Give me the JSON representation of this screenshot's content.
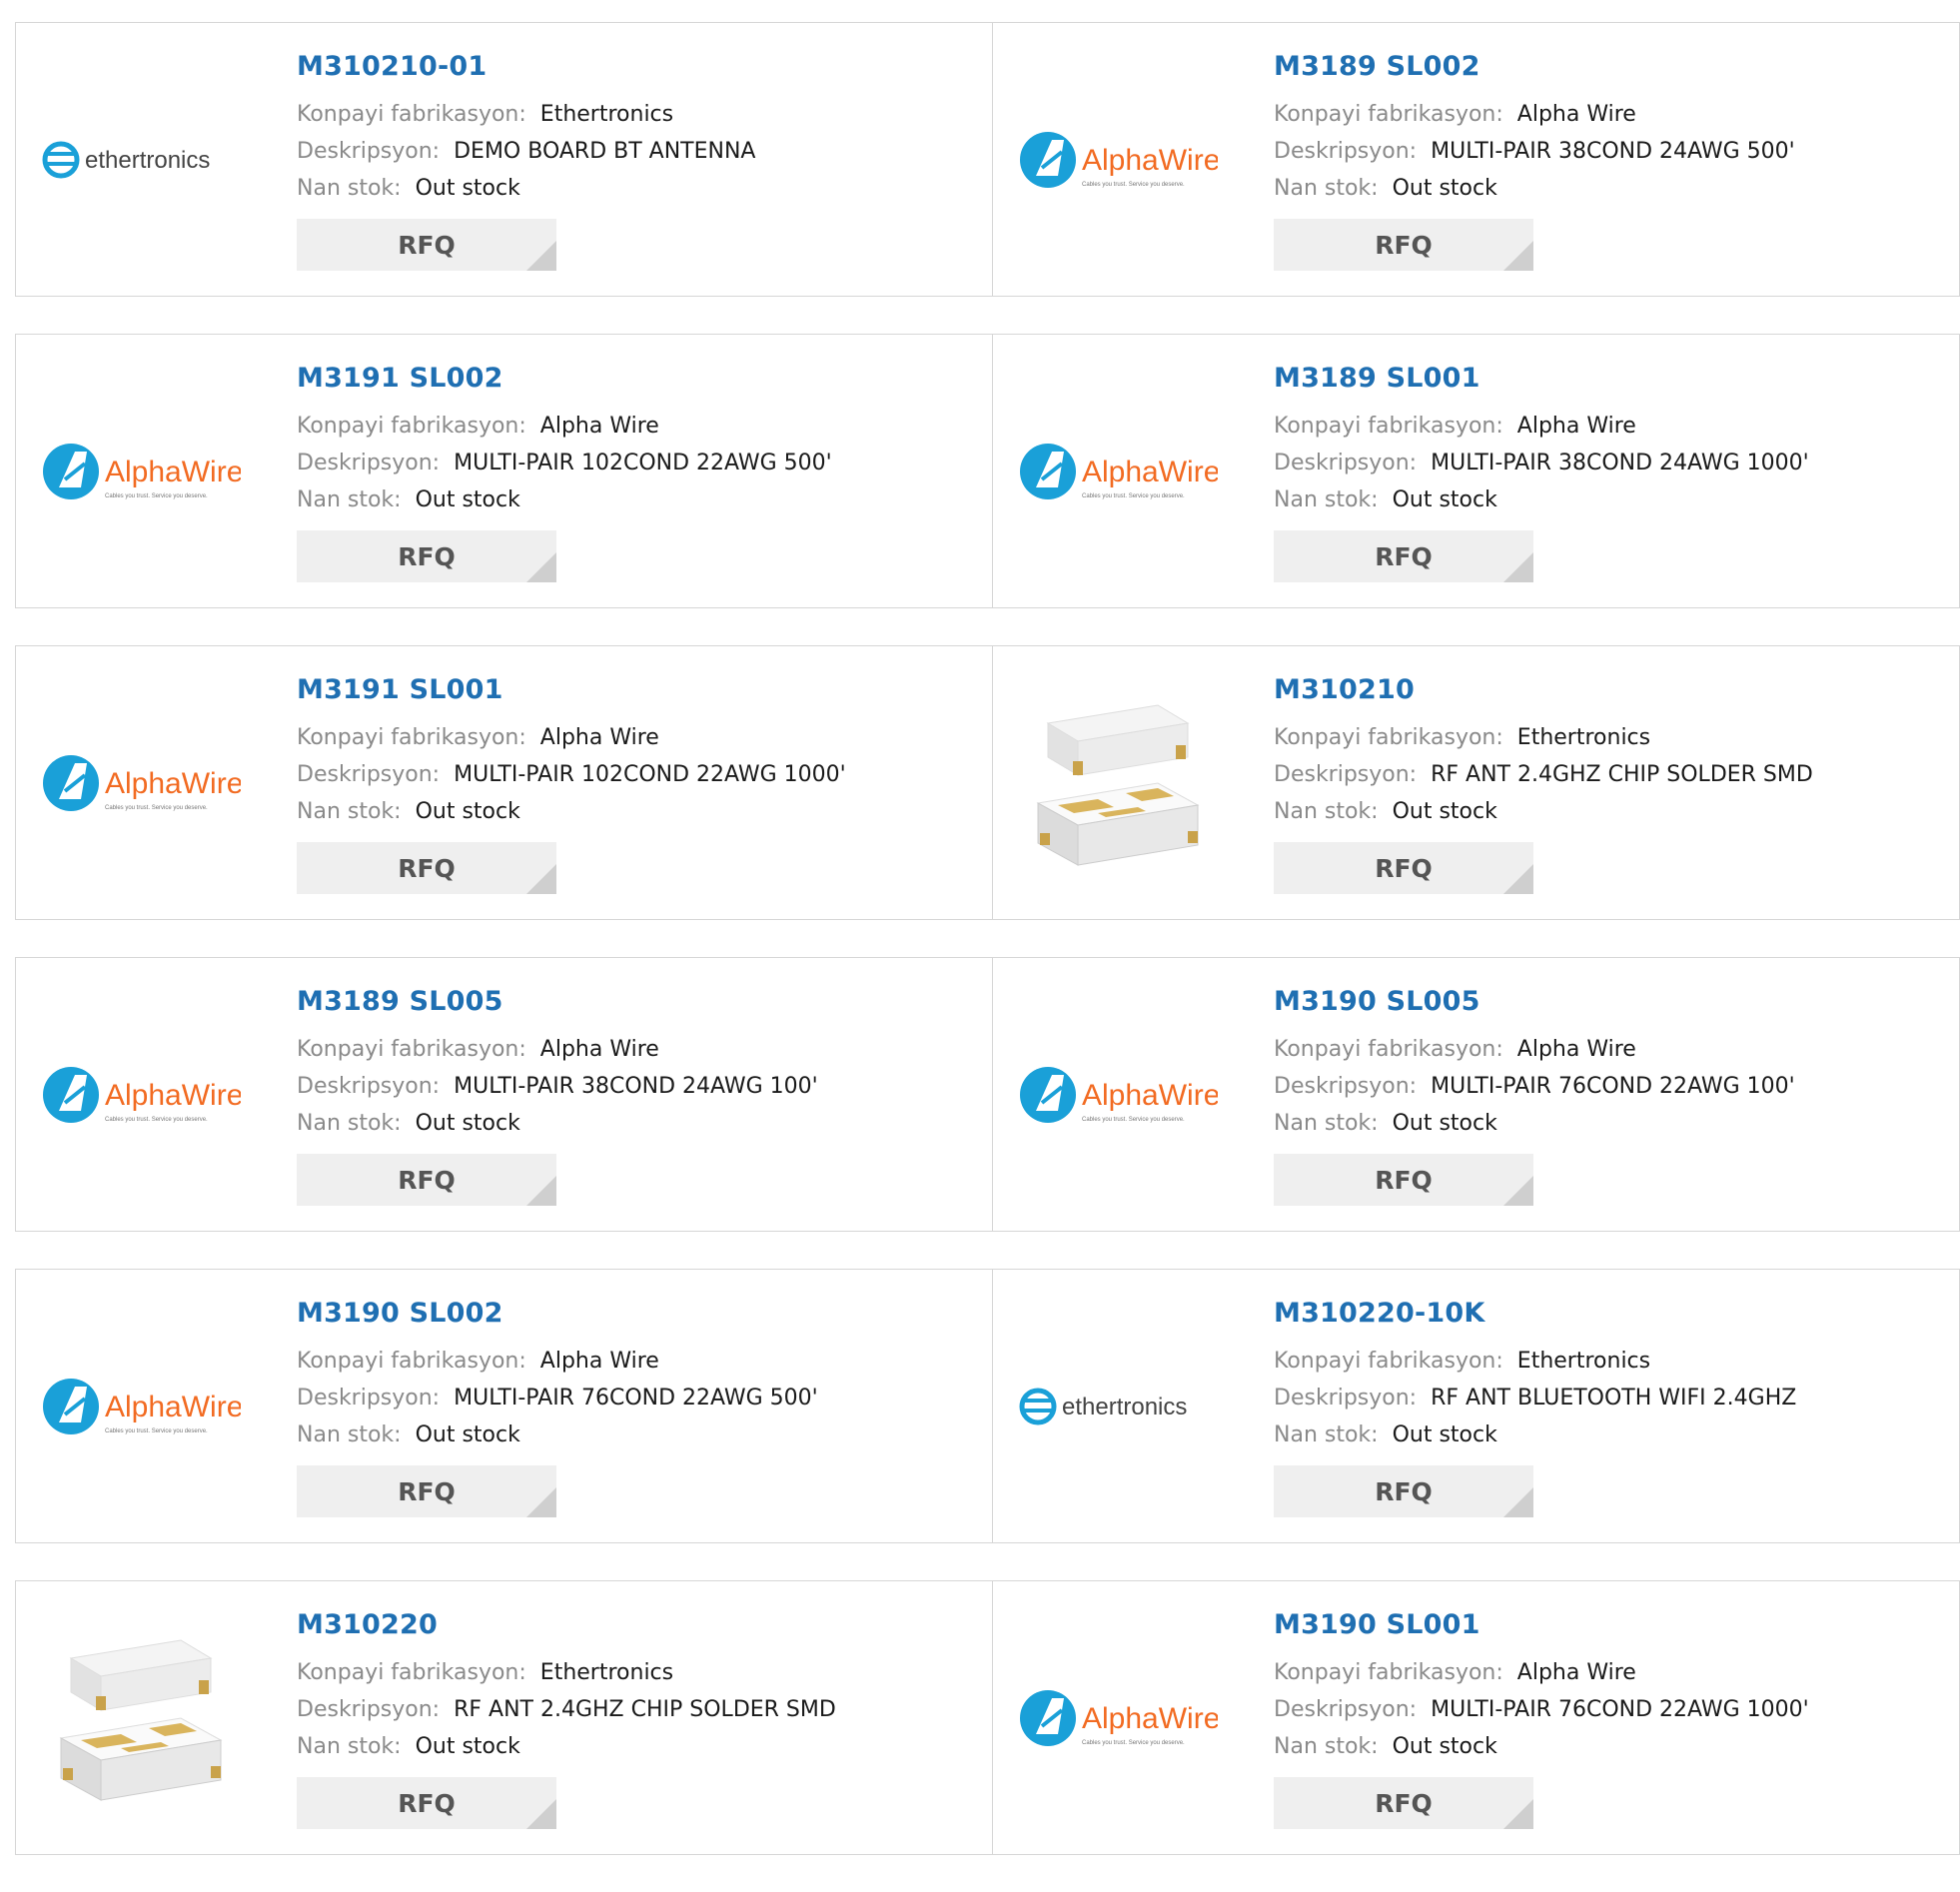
{
  "labels": {
    "manufacturer": "Konpayi fabrikasyon:",
    "description": "Deskripsyon:",
    "stock": "Nan stok:",
    "rfq": "RFQ"
  },
  "logos": {
    "ethertronics": {
      "text": "ethertronics",
      "color": "#1aa0d8"
    },
    "alphawire": {
      "text": "AlphaWire",
      "tagline": "Cables you trust. Service you deserve.",
      "color": "#f26b22",
      "badge_color": "#1aa0d8"
    }
  },
  "colors": {
    "link": "#1f6fb2",
    "border": "#d6d6d6",
    "button_bg": "#efefef"
  },
  "products": [
    {
      "part": "M310210-01",
      "manufacturer": "Ethertronics",
      "description": "DEMO BOARD BT ANTENNA",
      "stock": "Out stock",
      "logo": "ethertronics"
    },
    {
      "part": "M3189 SL002",
      "manufacturer": "Alpha Wire",
      "description": "MULTI-PAIR 38COND 24AWG 500'",
      "stock": "Out stock",
      "logo": "alphawire"
    },
    {
      "part": "M3191 SL002",
      "manufacturer": "Alpha Wire",
      "description": "MULTI-PAIR 102COND 22AWG 500'",
      "stock": "Out stock",
      "logo": "alphawire"
    },
    {
      "part": "M3189 SL001",
      "manufacturer": "Alpha Wire",
      "description": "MULTI-PAIR 38COND 24AWG 1000'",
      "stock": "Out stock",
      "logo": "alphawire"
    },
    {
      "part": "M3191 SL001",
      "manufacturer": "Alpha Wire",
      "description": "MULTI-PAIR 102COND 22AWG 1000'",
      "stock": "Out stock",
      "logo": "alphawire"
    },
    {
      "part": "M310210",
      "manufacturer": "Ethertronics",
      "description": "RF ANT 2.4GHZ CHIP SOLDER SMD",
      "stock": "Out stock",
      "logo": "chip"
    },
    {
      "part": "M3189 SL005",
      "manufacturer": "Alpha Wire",
      "description": "MULTI-PAIR 38COND 24AWG 100'",
      "stock": "Out stock",
      "logo": "alphawire"
    },
    {
      "part": "M3190 SL005",
      "manufacturer": "Alpha Wire",
      "description": "MULTI-PAIR 76COND 22AWG 100'",
      "stock": "Out stock",
      "logo": "alphawire"
    },
    {
      "part": "M3190 SL002",
      "manufacturer": "Alpha Wire",
      "description": "MULTI-PAIR 76COND 22AWG 500'",
      "stock": "Out stock",
      "logo": "alphawire"
    },
    {
      "part": "M310220-10K",
      "manufacturer": "Ethertronics",
      "description": "RF ANT BLUETOOTH WIFI 2.4GHZ",
      "stock": "Out stock",
      "logo": "ethertronics"
    },
    {
      "part": "M310220",
      "manufacturer": "Ethertronics",
      "description": "RF ANT 2.4GHZ CHIP SOLDER SMD",
      "stock": "Out stock",
      "logo": "chip"
    },
    {
      "part": "M3190 SL001",
      "manufacturer": "Alpha Wire",
      "description": "MULTI-PAIR 76COND 22AWG 1000'",
      "stock": "Out stock",
      "logo": "alphawire"
    }
  ]
}
